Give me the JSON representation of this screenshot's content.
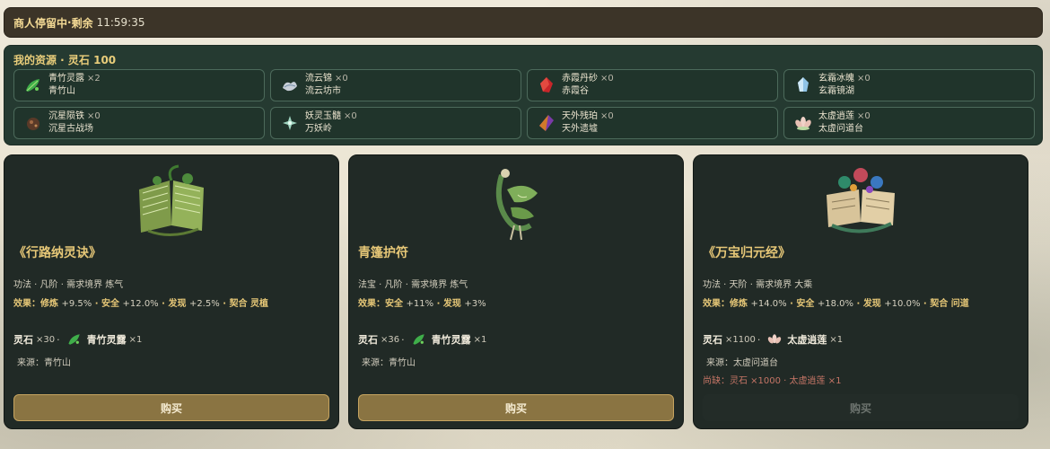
{
  "merchant": {
    "status": "商人停留中",
    "sep": " · ",
    "remain_label": "剩余",
    "timer": "11:59:35"
  },
  "resources": {
    "title": "我的资源 · 灵石 100",
    "items": [
      {
        "name": "青竹灵露",
        "count": "×2",
        "location": "青竹山",
        "icon": "green-leaf-icon",
        "color": "#3fae4a"
      },
      {
        "name": "流云锦",
        "count": "×0",
        "location": "流云坊市",
        "icon": "silk-cloud-icon",
        "color": "#c8cfd8"
      },
      {
        "name": "赤霞丹砂",
        "count": "×0",
        "location": "赤霞谷",
        "icon": "red-crystal-icon",
        "color": "#c8262a"
      },
      {
        "name": "玄霜冰魄",
        "count": "×0",
        "location": "玄霜镜湖",
        "icon": "ice-crystal-icon",
        "color": "#8fc3e6"
      },
      {
        "name": "沉星陨铁",
        "count": "×0",
        "location": "沉星古战场",
        "icon": "meteor-iron-icon",
        "color": "#8a5a3a"
      },
      {
        "name": "妖灵玉髓",
        "count": "×0",
        "location": "万妖岭",
        "icon": "jade-marrow-icon",
        "color": "#9fd4c0"
      },
      {
        "name": "天外残珀",
        "count": "×0",
        "location": "天外遗墟",
        "icon": "amber-shard-icon",
        "color": "#d07a2a"
      },
      {
        "name": "太虚逍莲",
        "count": "×0",
        "location": "太虚问道台",
        "icon": "lotus-icon",
        "color": "#f0d2c8"
      }
    ]
  },
  "cards": [
    {
      "title": "《行路纳灵诀》",
      "meta": "功法 · 凡阶 · 需求境界 炼气",
      "effect_label": "效果：",
      "effects": [
        {
          "k": "修炼",
          "v": "+9.5%"
        },
        {
          "k": "安全",
          "v": "+12.0%"
        },
        {
          "k": "发现",
          "v": "+2.5%"
        },
        {
          "k": "契合",
          "v": "灵植"
        }
      ],
      "cost_currency": "灵石",
      "cost_amount": "×30",
      "cost_item": "青竹灵露",
      "cost_item_amount": "×1",
      "source": "来源：青竹山",
      "shortage": "",
      "buy_label": "购买",
      "buy_enabled": true,
      "art_icon": "jade-book-icon"
    },
    {
      "title": "青篷护符",
      "meta": "法宝 · 凡阶 · 需求境界 炼气",
      "effect_label": "效果：",
      "effects": [
        {
          "k": "安全",
          "v": "+11%"
        },
        {
          "k": "发现",
          "v": "+3%"
        }
      ],
      "cost_currency": "灵石",
      "cost_amount": "×36",
      "cost_item": "青竹灵露",
      "cost_item_amount": "×1",
      "source": "来源：青竹山",
      "shortage": "",
      "buy_label": "购买",
      "buy_enabled": true,
      "art_icon": "green-talisman-icon"
    },
    {
      "title": "《万宝归元经》",
      "meta": "功法 · 天阶 · 需求境界 大乘",
      "effect_label": "效果：",
      "effects": [
        {
          "k": "修炼",
          "v": "+14.0%"
        },
        {
          "k": "安全",
          "v": "+18.0%"
        },
        {
          "k": "发现",
          "v": "+10.0%"
        },
        {
          "k": "契合",
          "v": "问道"
        }
      ],
      "cost_currency": "灵石",
      "cost_amount": "×1100",
      "cost_item": "太虚逍莲",
      "cost_item_amount": "×1",
      "source": "来源：太虚问道台",
      "shortage": "尚缺：灵石 ×1000 · 太虚逍莲 ×1",
      "buy_label": "购买",
      "buy_enabled": false,
      "art_icon": "treasure-scroll-icon"
    }
  ]
}
